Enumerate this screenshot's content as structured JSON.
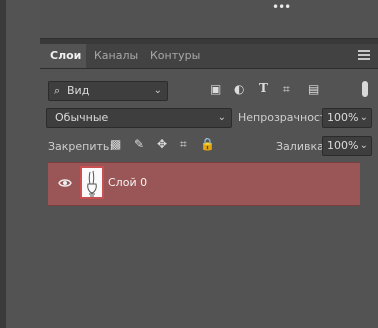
{
  "header": {
    "more_icon": "more-dots-icon"
  },
  "tabs": [
    {
      "label": "Слои",
      "active": true
    },
    {
      "label": "Каналы",
      "active": false
    },
    {
      "label": "Контуры",
      "active": false
    }
  ],
  "filter": {
    "search_icon": "search-icon",
    "value": "Вид",
    "icons": [
      "image-filter-icon",
      "adjustment-filter-icon",
      "type-filter-icon",
      "shape-filter-icon",
      "smart-object-filter-icon"
    ]
  },
  "blend": {
    "mode": "Обычные",
    "opacity_label": "Непрозрачность:",
    "opacity_value": "100%"
  },
  "lock": {
    "label": "Закрепить:",
    "icons": [
      "lock-transparent-icon",
      "lock-paint-icon",
      "lock-move-icon",
      "lock-artboard-icon",
      "lock-all-icon"
    ],
    "fill_label": "Заливка:",
    "fill_value": "100%"
  },
  "layers": [
    {
      "name": "Слой 0",
      "visible": true,
      "selected": true
    }
  ]
}
